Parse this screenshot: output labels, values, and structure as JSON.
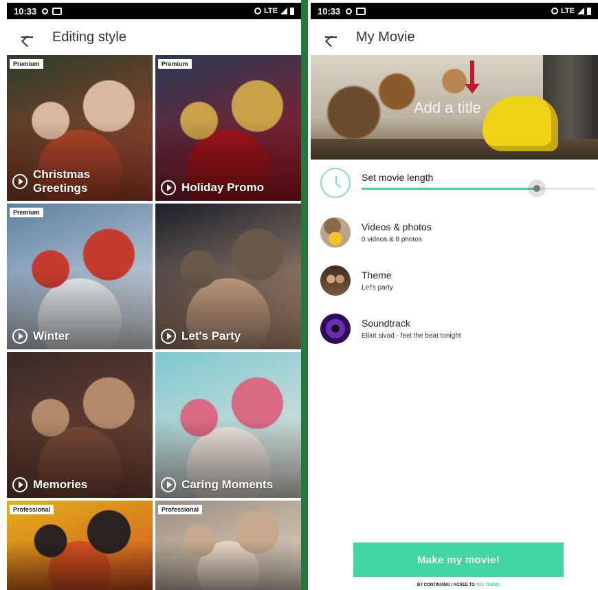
{
  "left": {
    "status": {
      "time": "10:33",
      "network": "LTE"
    },
    "appbar": {
      "title": "Editing style"
    },
    "tiles": [
      {
        "badge": "Premium",
        "label": "Christmas\nGreetings",
        "colors": [
          "#2c3c2a",
          "#b4462b",
          "#d9b8a0"
        ]
      },
      {
        "badge": "Premium",
        "label": "Holiday Promo",
        "colors": [
          "#2a3a57",
          "#a3151d",
          "#c9a14a"
        ]
      },
      {
        "badge": "Premium",
        "label": "Winter",
        "colors": [
          "#5d7fa0",
          "#e8ecef",
          "#c73a2f"
        ]
      },
      {
        "badge": "",
        "label": "Let's Party",
        "colors": [
          "#1b1f2a",
          "#c7a083",
          "#6a5a4a"
        ]
      },
      {
        "badge": "",
        "label": "Memories",
        "colors": [
          "#3a2a28",
          "#7a4a3a",
          "#b58a6a"
        ]
      },
      {
        "badge": "",
        "label": "Caring Moments",
        "colors": [
          "#7fc9cf",
          "#f0e7de",
          "#d96a83"
        ]
      },
      {
        "badge": "Professional",
        "label": "",
        "colors": [
          "#e0b21a",
          "#d45020",
          "#2a2220"
        ]
      },
      {
        "badge": "Professional",
        "label": "",
        "colors": [
          "#9a8e80",
          "#e8d8c8",
          "#c5a98a"
        ]
      }
    ]
  },
  "right": {
    "status": {
      "time": "10:33",
      "network": "LTE"
    },
    "appbar": {
      "title": "My Movie"
    },
    "hero": {
      "add_title": "Add a title"
    },
    "length": {
      "label": "Set movie length",
      "value_percent": 75
    },
    "items": [
      {
        "name": "Videos & photos",
        "sub": "0 videos  & 8 photos"
      },
      {
        "name": "Theme",
        "sub": "Let's party"
      },
      {
        "name": "Soundtrack",
        "sub": "Elliot sivad - feel the beat tonight"
      }
    ],
    "button": {
      "label": "Make my movie!"
    },
    "terms": {
      "text": "BY CONTINUING I AGREE TO",
      "link": "THE TERMS"
    }
  },
  "colors": {
    "accent": "#42d6a4",
    "divider": "#1f7a3c"
  }
}
